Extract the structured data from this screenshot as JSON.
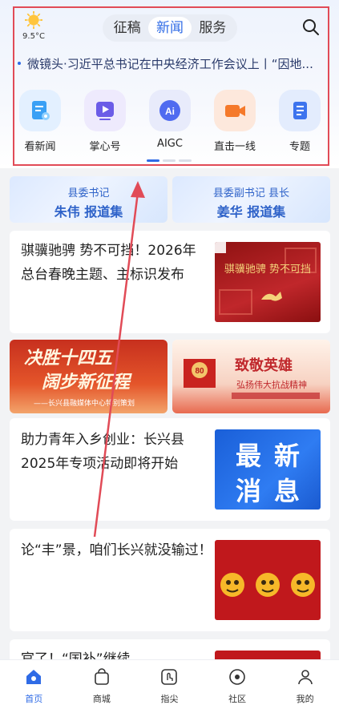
{
  "weather": {
    "temperature": "9.5°C",
    "icon": "sun-icon"
  },
  "tabs": [
    {
      "label": "征稿"
    },
    {
      "label": "新闻",
      "active": true
    },
    {
      "label": "服务"
    }
  ],
  "ticker": {
    "text": "微镜头·习近平总书记在中央经济工作会议上丨“因地..."
  },
  "quick_links": [
    {
      "label": "看新闻",
      "icon": "news-icon"
    },
    {
      "label": "掌心号",
      "icon": "video-play-icon"
    },
    {
      "label": "AIGC",
      "icon": "ai-icon"
    },
    {
      "label": "直击一线",
      "icon": "camera-icon"
    },
    {
      "label": "专题",
      "icon": "topic-doc-icon"
    }
  ],
  "leaders": [
    {
      "role": "县委书记",
      "name_line": "朱伟 报道集"
    },
    {
      "role": "县委副书记 县长",
      "name_line": "姜华 报道集"
    }
  ],
  "articles": [
    {
      "title": "骐骥驰骋 势不可挡！2026年总台春晚主题、主标识发布",
      "thumb_text": "骐骥驰骋 势不可挡"
    },
    {
      "title": "助力青年入乡创业：长兴县2025年专项活动即将开始",
      "thumb_text": [
        "最",
        "新",
        "消",
        "息"
      ]
    },
    {
      "title": "论“丰”景，咱们长兴就没输过！"
    },
    {
      "title": "官了！“国补”继续"
    }
  ],
  "promos": [
    {
      "line1": "决胜十四五",
      "line2": "阔步新征程",
      "sub": "——长兴县融媒体中心特别策划"
    },
    {
      "line1": "致敬英雄",
      "line2": "弘扬伟大抗战精神",
      "badge": "80"
    }
  ],
  "bottom_nav": [
    {
      "label": "首页",
      "icon": "home-icon",
      "active": true
    },
    {
      "label": "商城",
      "icon": "shopping-bag-icon"
    },
    {
      "label": "指尖",
      "icon": "fingertip-icon"
    },
    {
      "label": "社区",
      "icon": "community-icon"
    },
    {
      "label": "我的",
      "icon": "profile-icon"
    }
  ],
  "colors": {
    "accent": "#2f6be6",
    "annotation": "#e14b57",
    "red_theme": "#b71c1c"
  }
}
